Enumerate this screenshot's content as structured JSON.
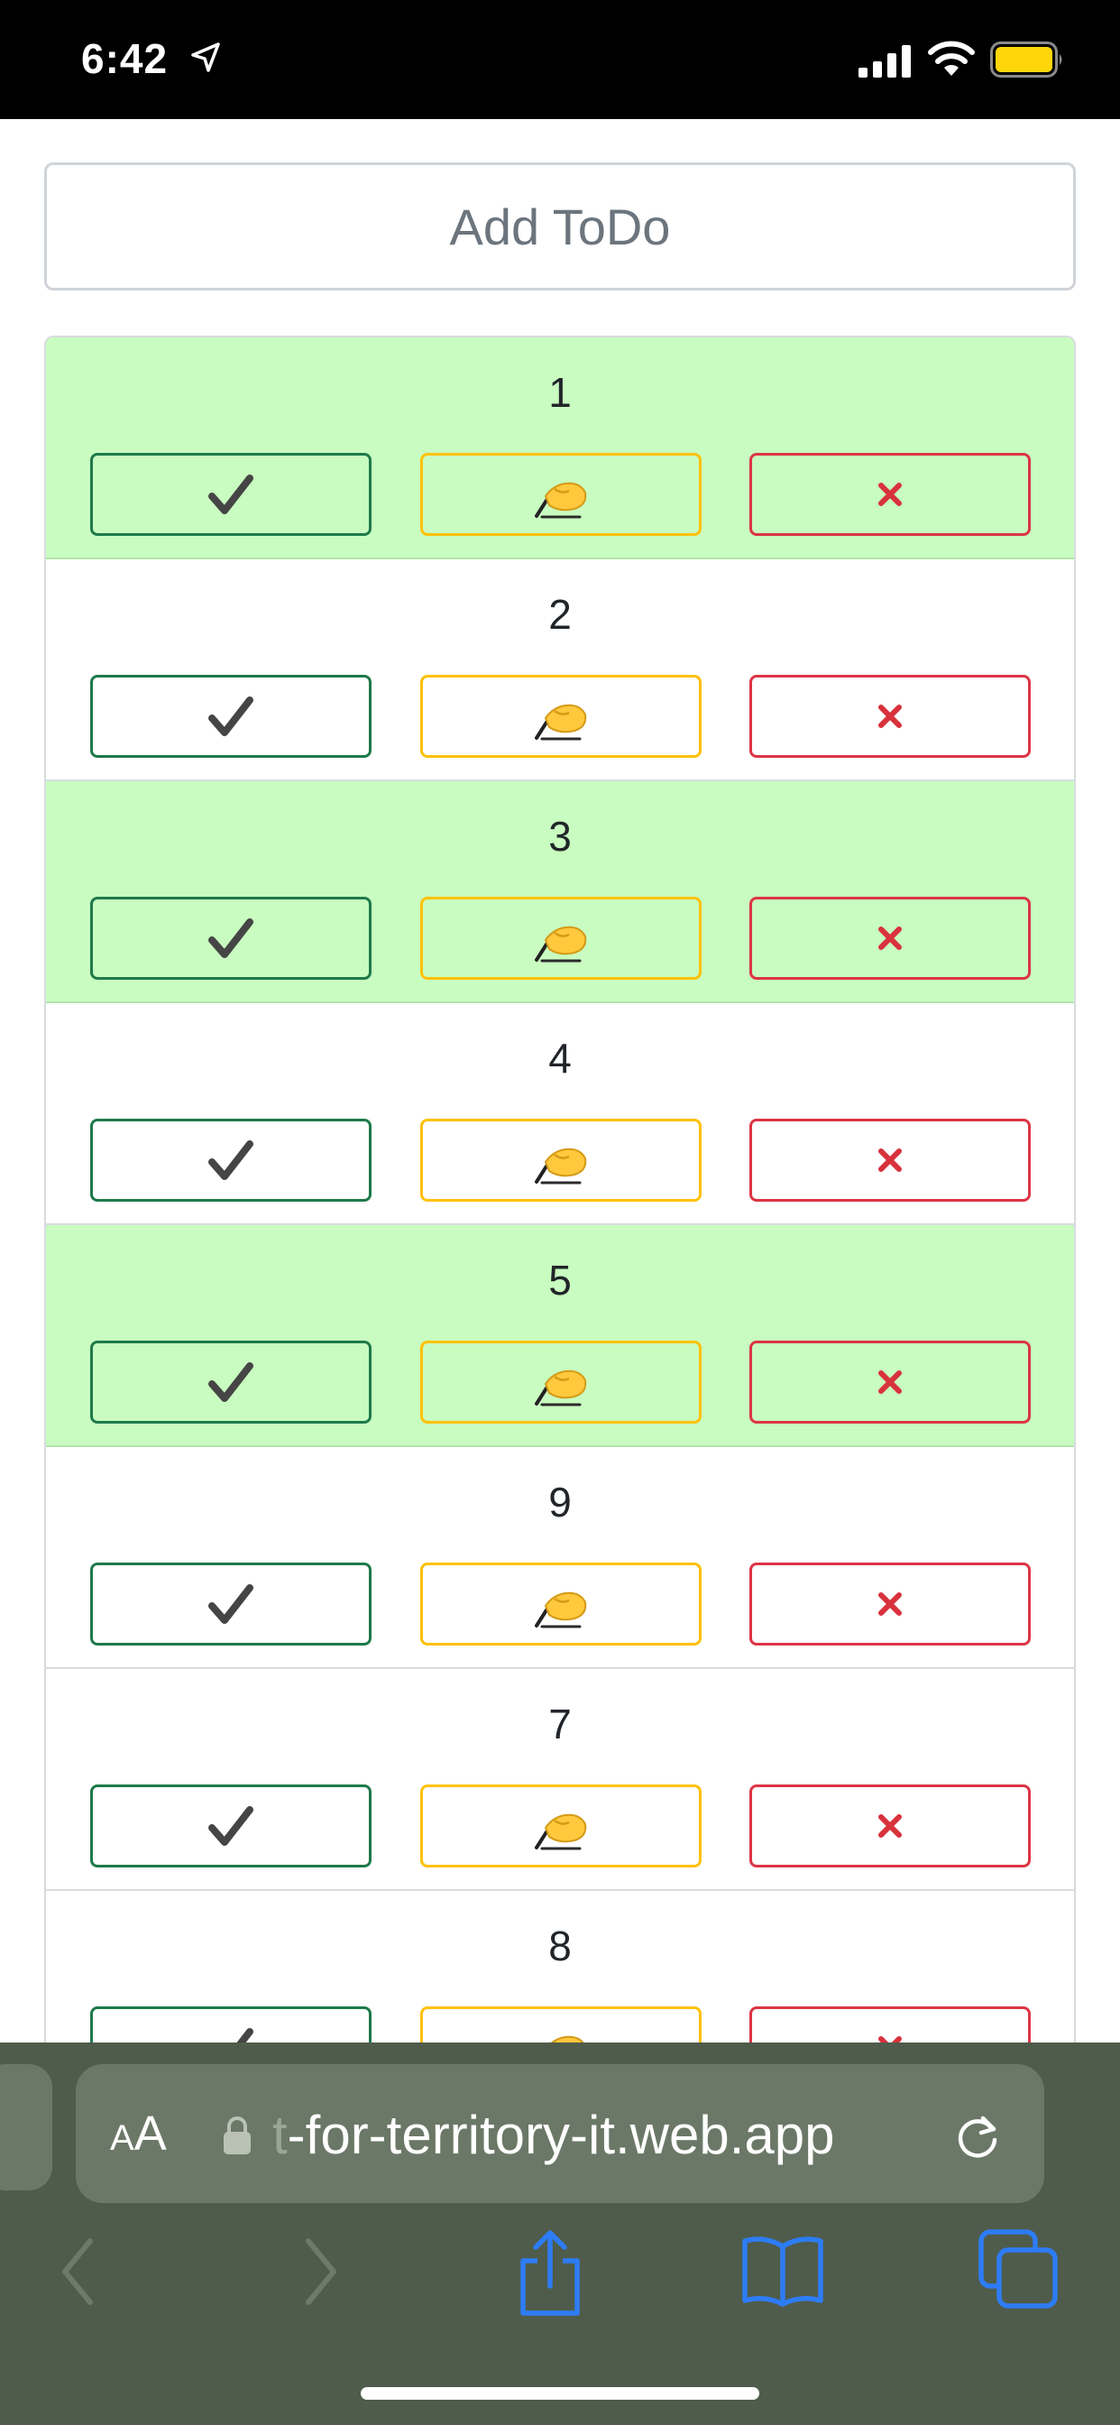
{
  "status_bar": {
    "time": "6:42",
    "location_icon": "location-arrow-icon",
    "signal_icon": "cellular-signal-icon",
    "wifi_icon": "wifi-icon",
    "battery_icon": "battery-icon",
    "battery_color": "#ffd60a"
  },
  "page": {
    "add_button_label": "Add ToDo",
    "done_row_color": "#c9fcc0",
    "todos": [
      {
        "title": "1",
        "done": true
      },
      {
        "title": "2",
        "done": false
      },
      {
        "title": "3",
        "done": true
      },
      {
        "title": "4",
        "done": false
      },
      {
        "title": "5",
        "done": true
      },
      {
        "title": "9",
        "done": false
      },
      {
        "title": "7",
        "done": false
      },
      {
        "title": "8",
        "done": false
      }
    ],
    "action_buttons": {
      "complete": {
        "label": "✔",
        "icon": "checkmark-icon",
        "border_color": "#1e7a4a"
      },
      "edit": {
        "label": "✍",
        "icon": "writing-hand-icon",
        "border_color": "#ffc107"
      },
      "delete": {
        "label": "✘",
        "icon": "cross-mark-icon",
        "border_color": "#dc3545"
      }
    }
  },
  "browser": {
    "text_size_button_small": "A",
    "text_size_button_large": "A",
    "url_faded_prefix": "t",
    "url_rest": "-for-territory-it.web.app",
    "lock_icon": "lock-icon",
    "reload_icon": "reload-icon",
    "toolbar": {
      "back_icon": "chevron-left-icon",
      "forward_icon": "chevron-right-icon",
      "share_icon": "share-icon",
      "bookmarks_icon": "book-icon",
      "tabs_icon": "tabs-icon"
    },
    "accent_color": "#2d7cf6"
  }
}
